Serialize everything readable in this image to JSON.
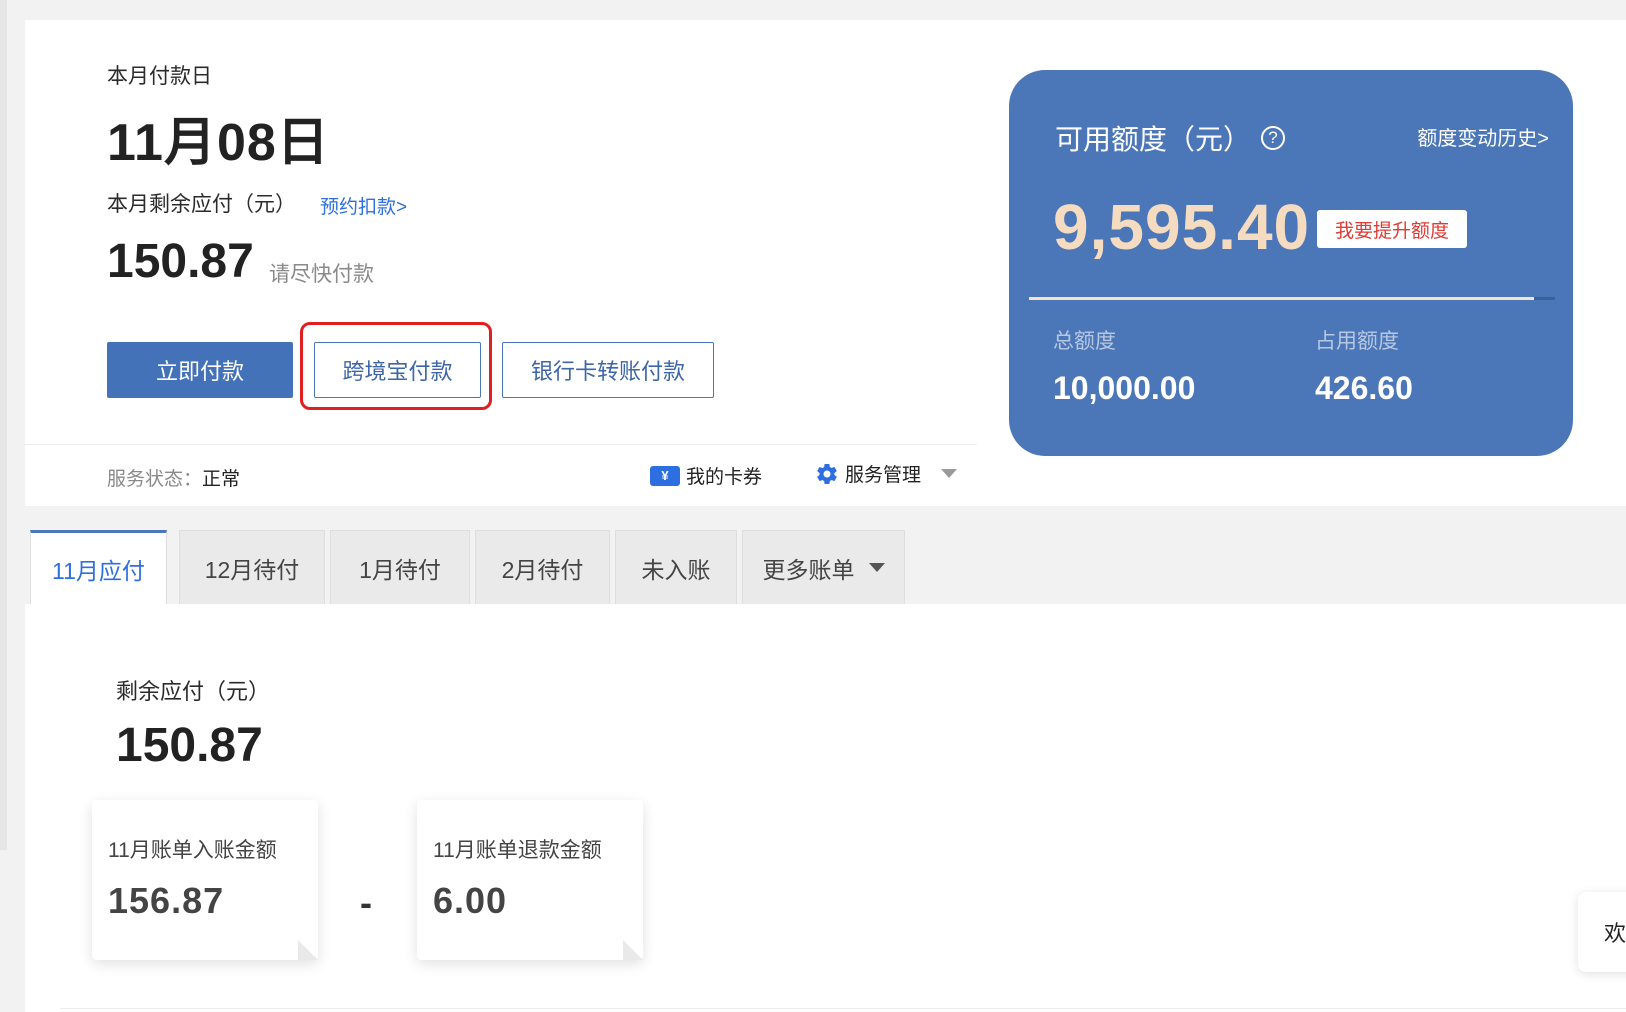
{
  "payment": {
    "due_label": "本月付款日",
    "due_date": "11月08日",
    "remaining_label": "本月剩余应付（元）",
    "schedule_link": "预约扣款>",
    "remaining_amount": "150.87",
    "remaining_hint": "请尽快付款",
    "pay_now": "立即付款",
    "pay_kjb": "跨境宝付款",
    "pay_bank": "银行卡转账付款"
  },
  "status_bar": {
    "status_label": "服务状态：",
    "status_value": "正常",
    "coupon_icon": "¥",
    "coupons": "我的卡券",
    "service": "服务管理"
  },
  "credit": {
    "title": "可用额度（元）",
    "help_icon": "?",
    "history_link": "额度变动历史>",
    "available": "9,595.40",
    "raise_button": "我要提升额度",
    "total_label": "总额度",
    "total_value": "10,000.00",
    "used_label": "占用额度",
    "used_value": "426.60",
    "available_fraction": 0.9595
  },
  "tabs": [
    {
      "label": "11月应付"
    },
    {
      "label": "12月待付"
    },
    {
      "label": "1月待付"
    },
    {
      "label": "2月待付"
    },
    {
      "label": "未入账"
    },
    {
      "label": "更多账单"
    }
  ],
  "bill": {
    "remaining_label": "剩余应付（元）",
    "remaining_amount": "150.87",
    "posted_label": "11月账单入账金额",
    "posted_amount": "156.87",
    "minus": "-",
    "refund_label": "11月账单退款金额",
    "refund_amount": "6.00"
  },
  "side_tab": {
    "label": "欢"
  },
  "colors": {
    "primary": "#4472b8",
    "card_bg": "#4b76b7",
    "link": "#2d6fe0",
    "highlight": "#e02020",
    "amount_gold": "#f5dcc0"
  }
}
